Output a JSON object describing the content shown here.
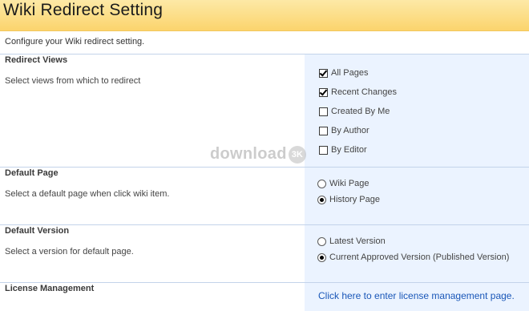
{
  "page": {
    "title": "Wiki Redirect Setting",
    "intro": "Configure your Wiki redirect setting."
  },
  "sections": {
    "redirect_views": {
      "title": "Redirect Views",
      "description": "Select views from which to redirect",
      "options": [
        {
          "label": "All Pages",
          "checked": true
        },
        {
          "label": "Recent Changes",
          "checked": true
        },
        {
          "label": "Created By Me",
          "checked": false
        },
        {
          "label": "By Author",
          "checked": false
        },
        {
          "label": "By Editor",
          "checked": false
        }
      ]
    },
    "default_page": {
      "title": "Default Page",
      "description": "Select a default page when click wiki item.",
      "options": [
        {
          "label": "Wiki Page",
          "selected": false
        },
        {
          "label": "History Page",
          "selected": true
        }
      ]
    },
    "default_version": {
      "title": "Default Version",
      "description": "Select a version for default page.",
      "options": [
        {
          "label": "Latest Version",
          "selected": false
        },
        {
          "label": "Current Approved Version (Published Version)",
          "selected": true
        }
      ]
    },
    "license": {
      "title": "License Management",
      "link": "Click here to enter license management page."
    }
  },
  "watermark": {
    "text": "download",
    "badge": "3K"
  }
}
